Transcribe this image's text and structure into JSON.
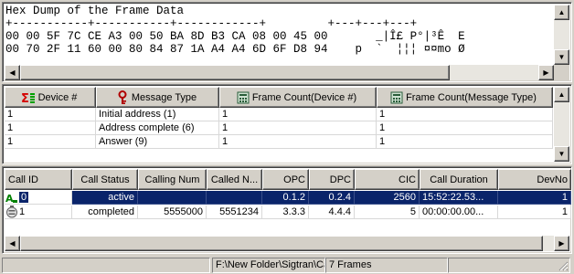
{
  "hex_dump": {
    "lines": [
      "Hex Dump of the Frame Data",
      "+-----------+-----------+------------+         +---+---+---+",
      "00 00 5F 7C CE A3 00 50 BA 8D B3 CA 08 00 45 00       _|Î£ P°|³Ê  E",
      "00 70 2F 11 60 00 80 84 87 1A A4 A4 6D 6F D8 94    p  `  ¦¦¦ ¤¤mo Ø"
    ]
  },
  "messages_table": {
    "columns": [
      {
        "label": "Device #",
        "icon": "sum-icon"
      },
      {
        "label": "Message Type",
        "icon": "key-icon"
      },
      {
        "label": "Frame Count(Device #)",
        "icon": "calculator-icon"
      },
      {
        "label": "Frame Count(Message Type)",
        "icon": "calculator-icon"
      }
    ],
    "rows": [
      [
        "1",
        "Initial address (1)",
        "1",
        "1"
      ],
      [
        "1",
        "Address complete (6)",
        "1",
        "1"
      ],
      [
        "1",
        "Answer (9)",
        "1",
        "1"
      ]
    ]
  },
  "calls_table": {
    "columns": [
      "Call ID",
      "Call Status",
      "Calling Num",
      "Called N...",
      "OPC",
      "DPC",
      "CIC",
      "Call Duration",
      "DevNo"
    ],
    "rows": [
      {
        "icon": "call-active-icon",
        "selected": true,
        "cells": [
          "0",
          "active",
          "",
          "",
          "0.1.2",
          "0.2.4",
          "2560",
          "15:52:22.53...",
          "1"
        ]
      },
      {
        "icon": "call-completed-icon",
        "selected": false,
        "cells": [
          "1",
          "completed",
          "5555000",
          "5551234",
          "3.3.3",
          "4.4.4",
          "5",
          "00:00:00.00...",
          "1"
        ]
      }
    ]
  },
  "status_bar": {
    "path": "F:\\New Folder\\Sigtran\\Cal",
    "frames": "7 Frames"
  },
  "colors": {
    "selection": "#0a246a",
    "face": "#d4d0c8",
    "sum_icon_red": "#d40000",
    "sum_icon_green": "#00a000"
  }
}
